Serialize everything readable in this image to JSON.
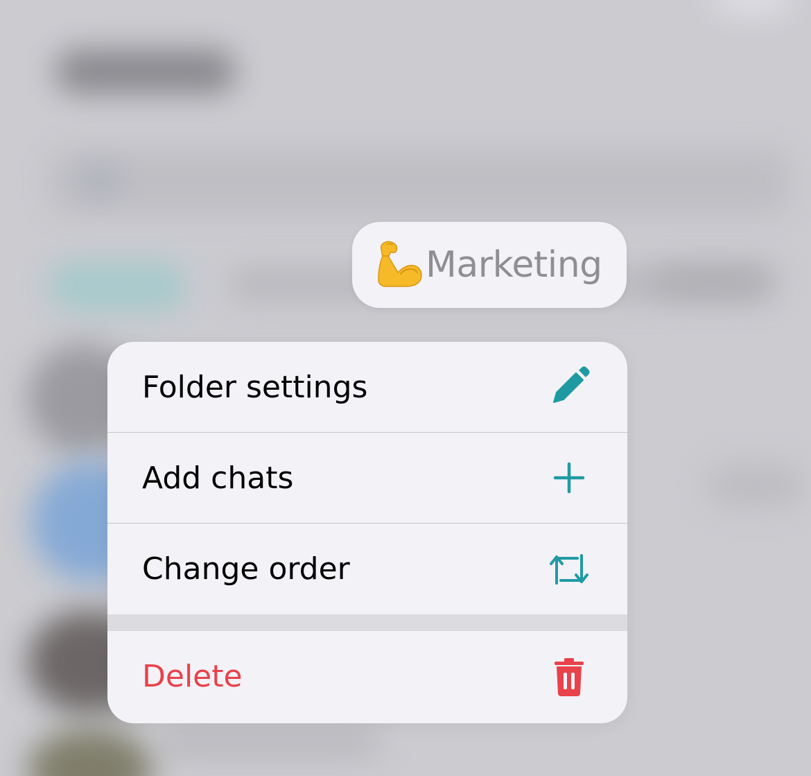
{
  "folder": {
    "emoji_icon": "flexed-biceps-icon",
    "label": "Marketing"
  },
  "menu": {
    "items": [
      {
        "label": "Folder settings",
        "icon": "pencil-icon"
      },
      {
        "label": "Add chats",
        "icon": "plus-icon"
      },
      {
        "label": "Change order",
        "icon": "reorder-arrows-icon"
      }
    ],
    "destructive": {
      "label": "Delete",
      "icon": "trash-icon"
    }
  },
  "colors": {
    "accent": "#1f9aa3",
    "destructive": "#e8424a",
    "menu_background": "#f2f2f7",
    "backdrop": "#cbcbd0"
  }
}
